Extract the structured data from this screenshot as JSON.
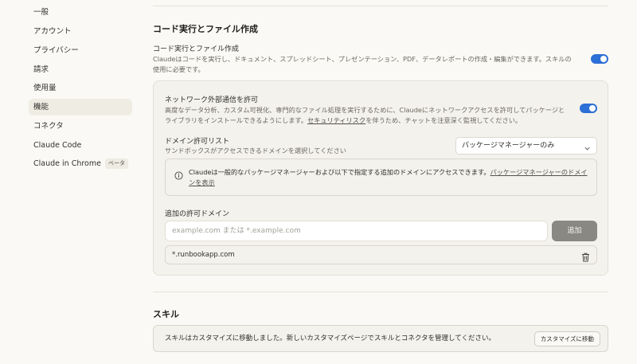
{
  "sidebar": {
    "items": [
      {
        "label": "一般"
      },
      {
        "label": "アカウント"
      },
      {
        "label": "プライバシー"
      },
      {
        "label": "請求"
      },
      {
        "label": "使用量"
      },
      {
        "label": "機能",
        "active": true
      },
      {
        "label": "コネクタ"
      },
      {
        "label": "Claude Code"
      },
      {
        "label": "Claude in Chrome",
        "badge": "ベータ"
      }
    ]
  },
  "code_section": {
    "title": "コード実行とファイル作成",
    "setting_label": "コード実行とファイル作成",
    "setting_desc": "Claudeはコードを実行し、ドキュメント、スプレッドシート、プレゼンテーション、PDF、データレポートの作成・編集ができます。スキルの使用に必要です。",
    "toggle_on": true
  },
  "network": {
    "label": "ネットワーク外部通信を許可",
    "desc": "高度なデータ分析、カスタム可視化、専門的なファイル処理を実行するために、Claudeにネットワークアクセスを許可してパッケージとライブラリをインストールできるようにします。",
    "desc_link": "セキュリティリスク",
    "desc_tail": "を伴うため、チャットを注意深く監視してください。",
    "toggle_on": true,
    "allowlist_label": "ドメイン許可リスト",
    "allowlist_desc": "サンドボックスがアクセスできるドメインを選択してください",
    "allowlist_value": "パッケージマネージャーのみ",
    "info_text": "Claudeは一般的なパッケージマネージャーおよび以下で指定する追加のドメインにアクセスできます。",
    "info_link": "パッケージマネージャーのドメインを表示",
    "additional_label": "追加の許可ドメイン",
    "input_placeholder": "example.com または *.example.com",
    "add_label": "追加",
    "domains": [
      "*.runbookapp.com"
    ]
  },
  "skills_section": {
    "title": "スキル",
    "notice": "スキルはカスタマイズに移動しました。新しいカスタマイズページでスキルとコネクタを管理してください。",
    "button_label": "カスタマイズに移動"
  },
  "colors": {
    "accent": "#2c6fd6",
    "background": "#faf9f5",
    "card": "#f4f2ec"
  }
}
